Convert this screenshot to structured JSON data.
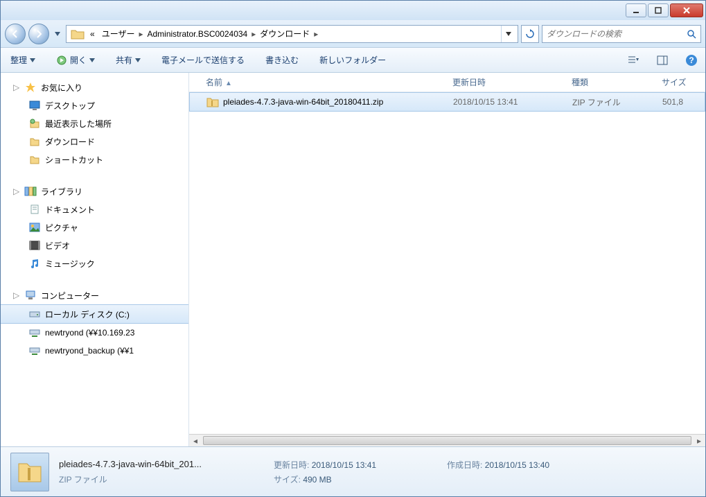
{
  "titlebar": {
    "minimize": "minimize",
    "maximize": "maximize",
    "close": "close"
  },
  "nav": {
    "back": "back",
    "forward": "forward",
    "crumbs": [
      "«",
      "ユーザー",
      "Administrator.BSC0024034",
      "ダウンロード"
    ],
    "search_placeholder": "ダウンロードの検索"
  },
  "toolbar": {
    "organize": "整理",
    "open": "開く",
    "share": "共有",
    "email": "電子メールで送信する",
    "burn": "書き込む",
    "new_folder": "新しいフォルダー"
  },
  "sidebar": {
    "favorites": {
      "header": "お気に入り",
      "items": [
        "デスクトップ",
        "最近表示した場所",
        "ダウンロード",
        "ショートカット"
      ]
    },
    "libraries": {
      "header": "ライブラリ",
      "items": [
        "ドキュメント",
        "ピクチャ",
        "ビデオ",
        "ミュージック"
      ]
    },
    "computer": {
      "header": "コンピューター",
      "items": [
        "ローカル ディスク (C:)",
        "newtryond (¥¥10.169.23",
        "newtryond_backup (¥¥1"
      ]
    }
  },
  "columns": {
    "name": "名前",
    "date": "更新日時",
    "type": "種類",
    "size": "サイズ"
  },
  "files": [
    {
      "name": "pleiades-4.7.3-java-win-64bit_20180411.zip",
      "date": "2018/10/15 13:41",
      "type": "ZIP ファイル",
      "size": "501,8"
    }
  ],
  "details": {
    "filename": "pleiades-4.7.3-java-win-64bit_201...",
    "filetype": "ZIP ファイル",
    "modified_label": "更新日時:",
    "modified_value": "2018/10/15 13:41",
    "size_label": "サイズ:",
    "size_value": "490 MB",
    "created_label": "作成日時:",
    "created_value": "2018/10/15 13:40"
  }
}
